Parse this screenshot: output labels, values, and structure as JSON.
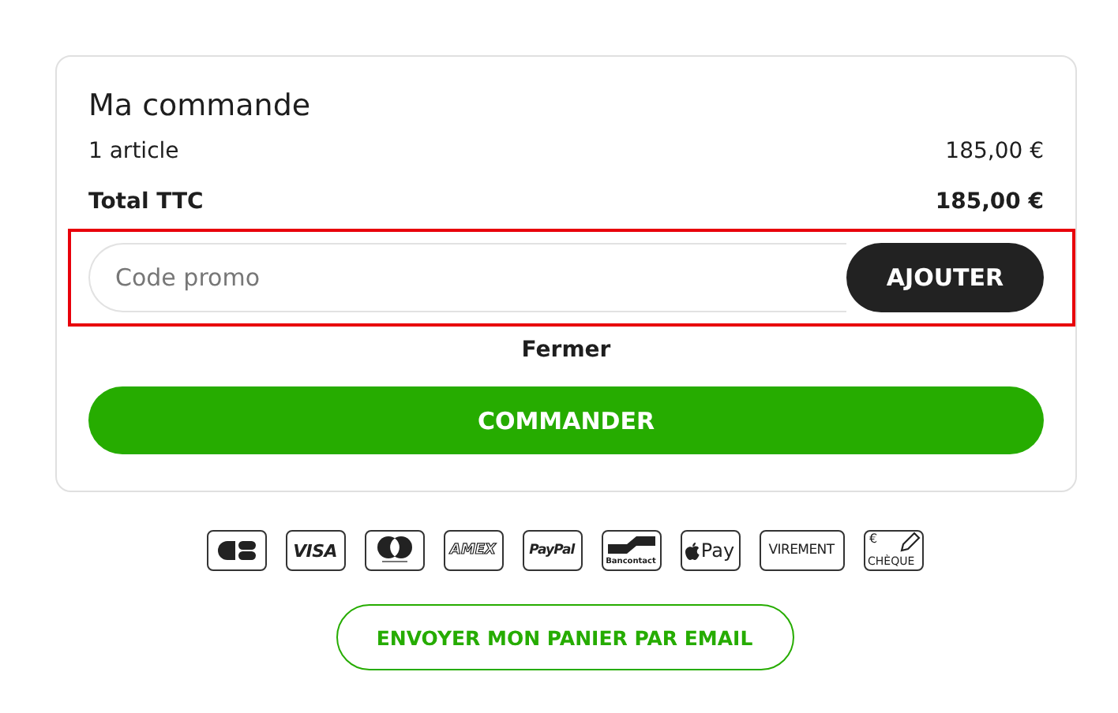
{
  "order": {
    "title": "Ma commande",
    "lines": [
      {
        "label": "1 article",
        "amount": "185,00 €",
        "kind": "normal"
      },
      {
        "label": "Total TTC",
        "amount": "185,00 €",
        "kind": "total"
      }
    ]
  },
  "promo": {
    "placeholder": "Code promo",
    "button": "AJOUTER",
    "highlighted": true
  },
  "close_link": "Fermer",
  "checkout_button": "COMMANDER",
  "payment_methods": [
    {
      "kind": "cb"
    },
    {
      "kind": "visa",
      "label": "VISA"
    },
    {
      "kind": "mastercard"
    },
    {
      "kind": "amex",
      "label": "AMEX"
    },
    {
      "kind": "paypal",
      "label": "PayPal"
    },
    {
      "kind": "bancontact",
      "label": "Bancontact"
    },
    {
      "kind": "applepay",
      "label": "Pay"
    },
    {
      "kind": "virement",
      "label": "VIREMENT"
    },
    {
      "kind": "cheque",
      "symbol": "€",
      "label": "CHÈQUE"
    }
  ],
  "email_button": "ENVOYER MON PANIER PAR EMAIL"
}
